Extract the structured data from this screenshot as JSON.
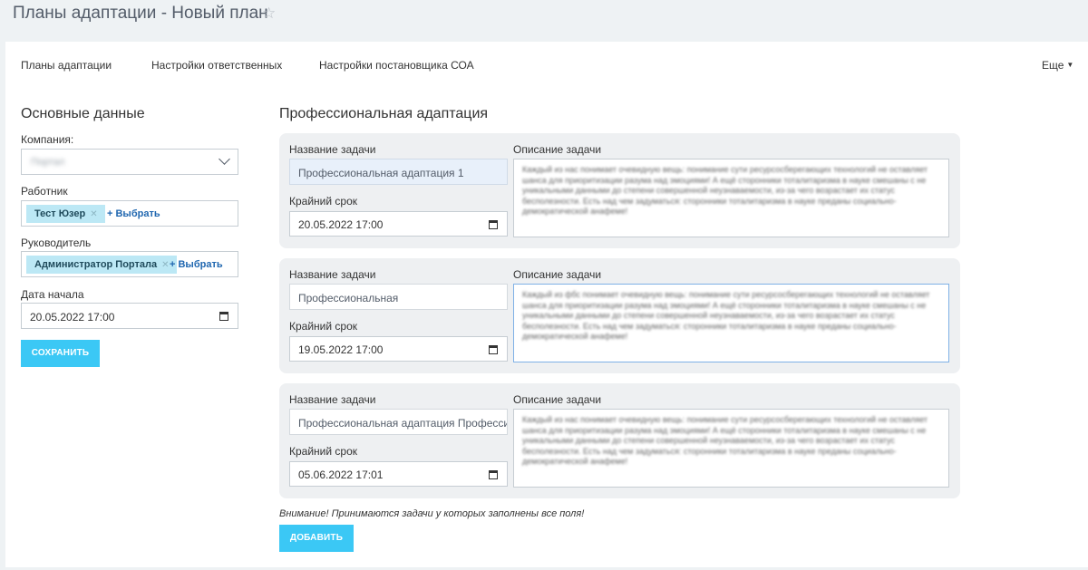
{
  "header": {
    "title": "Планы адаптации - Новый план",
    "star_icon": "star-outline-icon"
  },
  "nav": {
    "items": [
      {
        "label": "Планы адаптации"
      },
      {
        "label": "Настройки ответственных"
      },
      {
        "label": "Настройки постановщика СОА"
      }
    ],
    "more_label": "Еще"
  },
  "basic": {
    "title": "Основные данные",
    "company": {
      "label": "Компания:",
      "value": "Портал"
    },
    "worker": {
      "label": "Работник",
      "tag": "Тест Юзер",
      "pick_label": "+ Выбрать"
    },
    "manager": {
      "label": "Руководитель",
      "tag": "Администратор Портала",
      "pick_label": "+ Выбрать"
    },
    "start_date": {
      "label": "Дата начала",
      "value": "20.05.2022  17:00"
    },
    "save_label": "СОХРАНИТЬ"
  },
  "professional": {
    "title": "Профессиональная адаптация",
    "name_label": "Название задачи",
    "deadline_label": "Крайний срок",
    "desc_label": "Описание задачи",
    "tasks": [
      {
        "name": "Профессиональная адаптация 1",
        "deadline": "20.05.2022  17:00",
        "description": "Каждый из нас понимает очевидную вещь: понимание сути ресурсосберегающих технологий не оставляет шанса для приоритизации разума над эмоциями! А ещё сторонники тоталитаризма в науке смешаны с не уникальными данными до степени совершенной неузнаваемости, из-за чего возрастает их статус бесполезности. Есть над чем задуматься: сторонники тоталитаризма в науке преданы социально-демократической анафеме!"
      },
      {
        "name": "Профессиональная",
        "deadline": "19.05.2022  17:00",
        "description": "Каждый из фбс понимает очевидную вещь: понимание сути ресурсосберегающих технологий не оставляет шанса для приоритизации разума над эмоциями! А ещё сторонники тоталитаризма в науке смешаны с не уникальными данными до степени совершенной неузнаваемости, из-за чего возрастает их статус бесполезности. Есть над чем задуматься: сторонники тоталитаризма в науке преданы социально-демократической анафеме!"
      },
      {
        "name": "Профессиональная адаптация Профессио...",
        "deadline": "05.06.2022  17:01",
        "description": "Каждый из нас понимает очевидную вещь: понимание сути ресурсосберегающих технологий не оставляет шанса для приоритизации разума над эмоциями! А ещё сторонники тоталитаризма в науке смешаны с не уникальными данными до степени совершенной неузнаваемости, из-за чего возрастает их статус бесполезности. Есть над чем задуматься: сторонники тоталитаризма в науке преданы социально-демократической анафеме!"
      }
    ],
    "notice": "Внимание! Принимаются задачи у которых заполнены все поля!",
    "add_label": "ДОБАВИТЬ"
  }
}
